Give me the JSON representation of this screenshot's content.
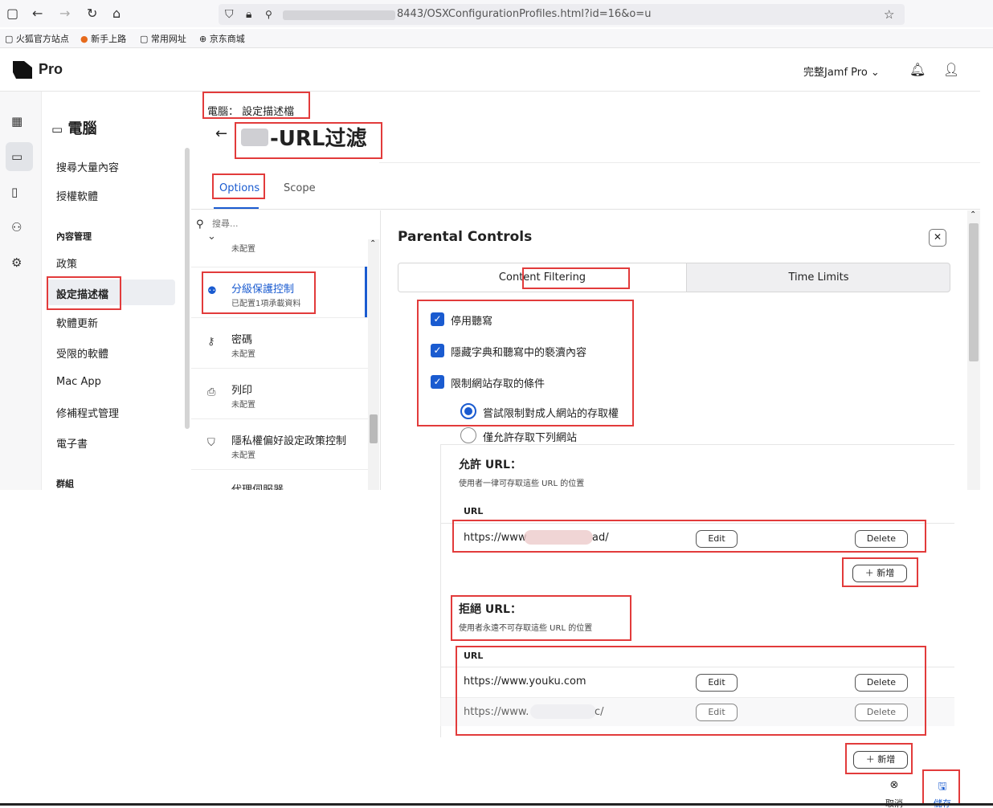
{
  "browser": {
    "url": "8443/OSXConfigurationProfiles.html?id=16&o=u",
    "bookmarks": [
      "火狐官方站点",
      "新手上路",
      "常用网址",
      "京东商城"
    ]
  },
  "app": {
    "brand": "Pro",
    "tenant": "完整Jamf Pro"
  },
  "sidebar": {
    "title": "電腦",
    "items_top": [
      "搜尋大量內容",
      "授權軟體"
    ],
    "section_content": "內容管理",
    "items_content": [
      "政策",
      "設定描述檔",
      "軟體更新",
      "受限的軟體",
      "Mac App",
      "修補程式管理",
      "電子書"
    ],
    "section_groups": "群組",
    "active": "設定描述檔"
  },
  "header": {
    "breadcrumb": "電腦： 設定描述檔",
    "title": "-URL过滤",
    "tabs": [
      "Options",
      "Scope"
    ],
    "active_tab": "Options"
  },
  "payloads": {
    "search_placeholder": "搜尋...",
    "items": [
      {
        "name": "",
        "status": "未配置",
        "icon": "chevron-icon"
      },
      {
        "name": "分級保護控制",
        "status": "已配置1項承載資料",
        "icon": "parental-icon"
      },
      {
        "name": "密碼",
        "status": "未配置",
        "icon": "key-icon"
      },
      {
        "name": "列印",
        "status": "未配置",
        "icon": "printer-icon"
      },
      {
        "name": "隱私權偏好設定政策控制",
        "status": "未配置",
        "icon": "shield-icon"
      },
      {
        "name": "代理伺服器",
        "status": "",
        "icon": "proxy-icon"
      }
    ]
  },
  "panel": {
    "title": "Parental Controls",
    "seg_tabs": [
      "Content Filtering",
      "Time Limits"
    ],
    "checkboxes": [
      "停用聽寫",
      "隱藏字典和聽寫中的褻瀆內容",
      "限制網站存取的條件"
    ],
    "radios": [
      "嘗試限制對成人網站的存取權",
      "僅允許存取下列網站"
    ],
    "allow": {
      "title": "允許 URL：",
      "desc": "使用者一律可存取這些 URL 的位置",
      "col": "URL",
      "rows": [
        {
          "prefix": "https://www",
          "suffix": "ad/"
        }
      ]
    },
    "deny": {
      "title": "拒絕 URL：",
      "desc": "使用者永遠不可存取這些 URL 的位置",
      "col": "URL",
      "rows": [
        {
          "prefix": "https://www.youku.com",
          "suffix": ""
        },
        {
          "prefix": "https://www.",
          "suffix": "c/"
        }
      ]
    },
    "edit_label": "Edit",
    "delete_label": "Delete",
    "add_label": "新增"
  },
  "footer": {
    "cancel": "取消",
    "save": "儲存"
  },
  "colors": {
    "accent": "#1a5bd0",
    "annotation": "#e23b3b"
  }
}
